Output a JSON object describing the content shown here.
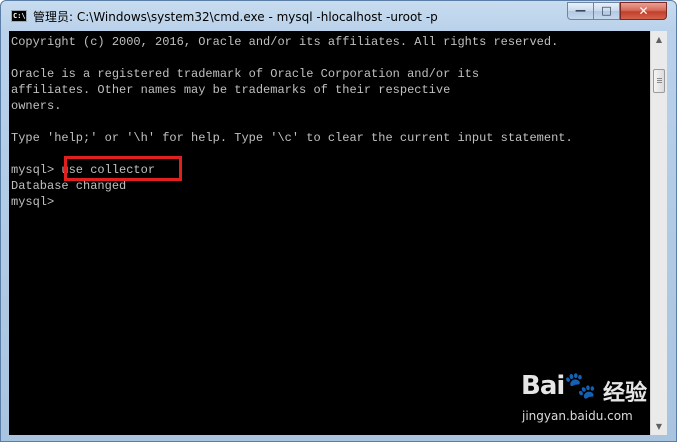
{
  "window": {
    "title": "管理员: C:\\Windows\\system32\\cmd.exe - mysql  -hlocalhost -uroot -p",
    "icon_label": "C:\\",
    "buttons": {
      "minimize": "—",
      "maximize": "□",
      "close": "✕"
    }
  },
  "console": {
    "lines": [
      "Copyright (c) 2000, 2016, Oracle and/or its affiliates. All rights reserved.",
      "",
      "Oracle is a registered trademark of Oracle Corporation and/or its",
      "affiliates. Other names may be trademarks of their respective",
      "owners.",
      "",
      "Type 'help;' or '\\h' for help. Type '\\c' to clear the current input statement.",
      "",
      "mysql> use collector",
      "Database changed",
      "mysql>"
    ],
    "text_color": "#c0c0c0",
    "background": "#000000"
  },
  "annotation": {
    "highlight_color": "#e0201e"
  },
  "scrollbar": {
    "up_arrow": "▲",
    "down_arrow": "▼"
  },
  "watermark": {
    "logo": "Bai🐾",
    "brand_cn": "经验",
    "url": "jingyan.baidu.com"
  }
}
